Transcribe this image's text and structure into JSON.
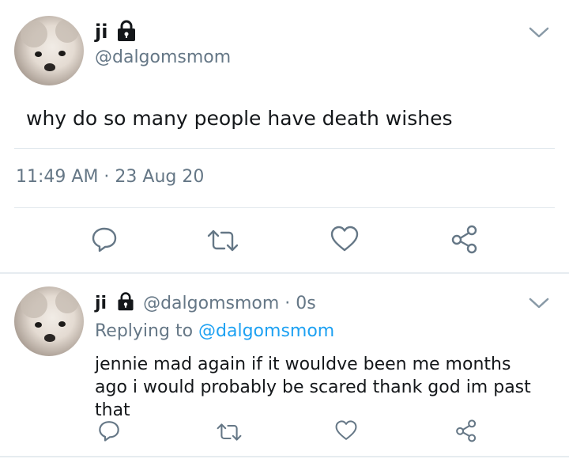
{
  "main_tweet": {
    "display_name": "ji",
    "handle": "@dalgomsmom",
    "text": "why do so many people have death wishes",
    "timestamp": "11:49 AM · 23 Aug 20",
    "protected_icon": "lock-icon",
    "menu_icon": "chevron-down-icon",
    "actions": [
      "reply-icon",
      "retweet-icon",
      "like-icon",
      "share-icon"
    ]
  },
  "reply_tweet": {
    "display_name": "ji",
    "handle": "@dalgomsmom",
    "separator": "·",
    "age": "0s",
    "replying_prefix": "Replying to",
    "replying_to": "@dalgomsmom",
    "text": "jennie mad again if it wouldve been me months ago i would probably be scared thank god im past that",
    "protected_icon": "lock-icon",
    "menu_icon": "chevron-down-icon",
    "actions": [
      "reply-icon",
      "retweet-icon",
      "like-icon",
      "share-icon"
    ]
  },
  "colors": {
    "text": "#14171a",
    "secondary": "#657786",
    "link": "#1da1f2",
    "divider": "#e1e8ed"
  }
}
